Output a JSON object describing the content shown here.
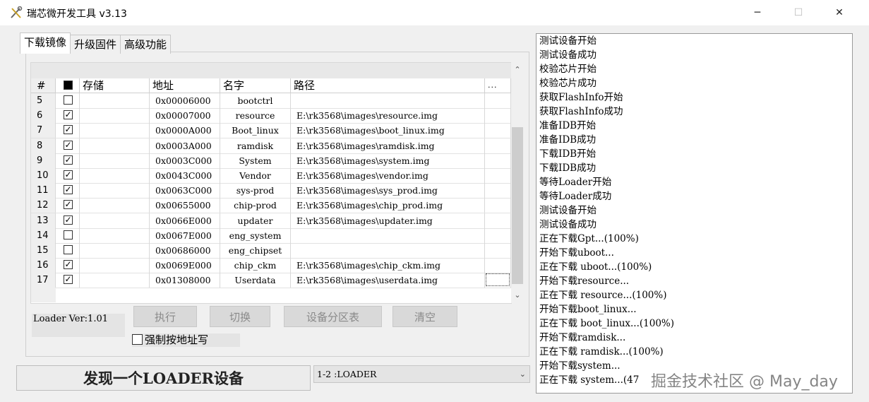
{
  "window": {
    "title": "瑞芯微开发工具 v3.13",
    "minimize": "─",
    "maximize": "☐",
    "close": "✕"
  },
  "tabs": [
    {
      "label": "下载镜像",
      "active": true
    },
    {
      "label": "升级固件",
      "active": false
    },
    {
      "label": "高级功能",
      "active": false
    }
  ],
  "table": {
    "headers": {
      "num": "#",
      "store": "存储",
      "addr": "地址",
      "name": "名字",
      "path": "路径",
      "dots": "..."
    },
    "rows": [
      {
        "num": "5",
        "checked": false,
        "addr": "0x00006000",
        "name": "bootctrl",
        "path": ""
      },
      {
        "num": "6",
        "checked": true,
        "addr": "0x00007000",
        "name": "resource",
        "path": "E:\\rk3568\\images\\resource.img"
      },
      {
        "num": "7",
        "checked": true,
        "addr": "0x0000A000",
        "name": "Boot_linux",
        "path": "E:\\rk3568\\images\\boot_linux.img"
      },
      {
        "num": "8",
        "checked": true,
        "addr": "0x0003A000",
        "name": "ramdisk",
        "path": "E:\\rk3568\\images\\ramdisk.img"
      },
      {
        "num": "9",
        "checked": true,
        "addr": "0x0003C000",
        "name": "System",
        "path": "E:\\rk3568\\images\\system.img"
      },
      {
        "num": "10",
        "checked": true,
        "addr": "0x0043C000",
        "name": "Vendor",
        "path": "E:\\rk3568\\images\\vendor.img"
      },
      {
        "num": "11",
        "checked": true,
        "addr": "0x0063C000",
        "name": "sys-prod",
        "path": "E:\\rk3568\\images\\sys_prod.img"
      },
      {
        "num": "12",
        "checked": true,
        "addr": "0x00655000",
        "name": "chip-prod",
        "path": "E:\\rk3568\\images\\chip_prod.img"
      },
      {
        "num": "13",
        "checked": true,
        "addr": "0x0066E000",
        "name": "updater",
        "path": "E:\\rk3568\\images\\updater.img"
      },
      {
        "num": "14",
        "checked": false,
        "addr": "0x0067E000",
        "name": "eng_system",
        "path": ""
      },
      {
        "num": "15",
        "checked": false,
        "addr": "0x00686000",
        "name": "eng_chipset",
        "path": ""
      },
      {
        "num": "16",
        "checked": true,
        "addr": "0x0069E000",
        "name": "chip_ckm",
        "path": "E:\\rk3568\\images\\chip_ckm.img"
      },
      {
        "num": "17",
        "checked": true,
        "addr": "0x01308000",
        "name": "Userdata",
        "path": "E:\\rk3568\\images\\userdata.img"
      }
    ]
  },
  "loader_version": "Loader Ver:1.01",
  "buttons": {
    "execute": "执行",
    "switch": "切换",
    "partition_table": "设备分区表",
    "clear": "清空"
  },
  "force_address_write": {
    "label": "强制按地址写",
    "checked": false
  },
  "status_text": "发现一个LOADER设备",
  "device_combo": {
    "value": "1-2 :LOADER"
  },
  "log": [
    "测试设备开始",
    "测试设备成功",
    "校验芯片开始",
    "校验芯片成功",
    "获取FlashInfo开始",
    "获取FlashInfo成功",
    "准备IDB开始",
    "准备IDB成功",
    "下载IDB开始",
    "下载IDB成功",
    "等待Loader开始",
    "等待Loader成功",
    "测试设备开始",
    "测试设备成功",
    "正在下载Gpt...(100%)",
    "开始下载uboot...",
    "正在下载 uboot...(100%)",
    "开始下载resource...",
    "正在下载 resource...(100%)",
    "开始下载boot_linux...",
    "正在下载 boot_linux...(100%)",
    "开始下载ramdisk...",
    "正在下载 ramdisk...(100%)",
    "开始下载system...",
    "正在下载 system...(47"
  ],
  "watermark": "掘金技术社区 @ May_day"
}
